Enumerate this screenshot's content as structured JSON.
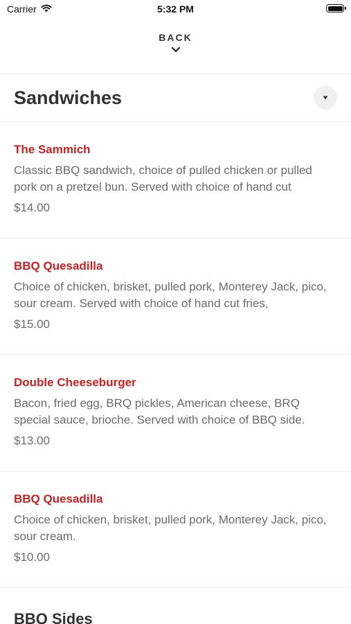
{
  "status_bar": {
    "carrier": "Carrier",
    "time": "5:32 PM"
  },
  "back": {
    "label": "BACK"
  },
  "section": {
    "title": "Sandwiches"
  },
  "items": [
    {
      "name": "The Sammich",
      "description": "Classic BBQ sandwich, choice of pulled chicken or pulled pork on a pretzel bun. Served with choice of hand cut",
      "price": "$14.00"
    },
    {
      "name": "BBQ Quesadilla",
      "description": "Choice of chicken, brisket, pulled pork, Monterey Jack, pico, sour cream. Served with choice of hand cut fries,",
      "price": "$15.00"
    },
    {
      "name": "Double Cheeseburger",
      "description": "Bacon, fried egg, BRQ pickles, American cheese, BRQ special sauce, brioche. Served with choice of BBQ side.",
      "price": "$13.00"
    },
    {
      "name": "BBQ Quesadilla",
      "description": "Choice of chicken, brisket, pulled pork, Monterey Jack, pico, sour cream.",
      "price": "$10.00"
    }
  ],
  "next_section": {
    "title": "BBQ Sides"
  },
  "colors": {
    "item_name": "#cc1f1f",
    "text_muted": "#6b6b6b",
    "divider": "#ececec"
  }
}
